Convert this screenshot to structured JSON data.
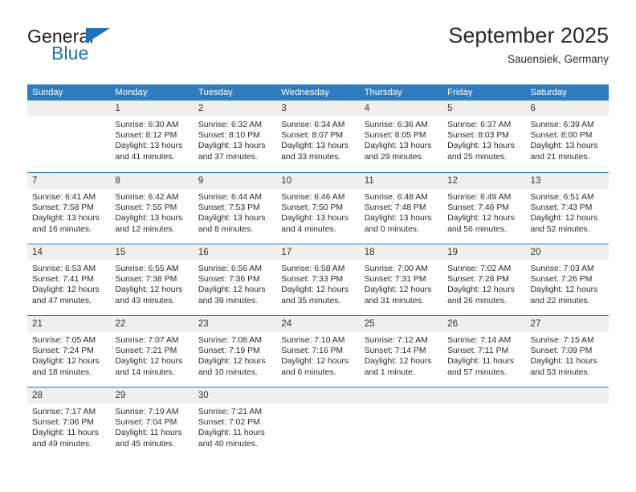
{
  "brand": {
    "name_dark": "General",
    "name_blue": "Blue",
    "accent_color": "#1f72b8"
  },
  "header": {
    "title": "September 2025",
    "subtitle": "Sauensiek, Germany"
  },
  "calendar": {
    "header_bg": "#2f7cbf",
    "daynum_bg": "#efefef",
    "weekdays": [
      "Sunday",
      "Monday",
      "Tuesday",
      "Wednesday",
      "Thursday",
      "Friday",
      "Saturday"
    ],
    "weeks": [
      [
        {
          "day": "",
          "empty": true,
          "sunrise": "",
          "sunset": "",
          "daylight1": "",
          "daylight2": ""
        },
        {
          "day": "1",
          "sunrise": "Sunrise: 6:30 AM",
          "sunset": "Sunset: 8:12 PM",
          "daylight1": "Daylight: 13 hours",
          "daylight2": "and 41 minutes."
        },
        {
          "day": "2",
          "sunrise": "Sunrise: 6:32 AM",
          "sunset": "Sunset: 8:10 PM",
          "daylight1": "Daylight: 13 hours",
          "daylight2": "and 37 minutes."
        },
        {
          "day": "3",
          "sunrise": "Sunrise: 6:34 AM",
          "sunset": "Sunset: 8:07 PM",
          "daylight1": "Daylight: 13 hours",
          "daylight2": "and 33 minutes."
        },
        {
          "day": "4",
          "sunrise": "Sunrise: 6:36 AM",
          "sunset": "Sunset: 8:05 PM",
          "daylight1": "Daylight: 13 hours",
          "daylight2": "and 29 minutes."
        },
        {
          "day": "5",
          "sunrise": "Sunrise: 6:37 AM",
          "sunset": "Sunset: 8:03 PM",
          "daylight1": "Daylight: 13 hours",
          "daylight2": "and 25 minutes."
        },
        {
          "day": "6",
          "sunrise": "Sunrise: 6:39 AM",
          "sunset": "Sunset: 8:00 PM",
          "daylight1": "Daylight: 13 hours",
          "daylight2": "and 21 minutes."
        }
      ],
      [
        {
          "day": "7",
          "sunrise": "Sunrise: 6:41 AM",
          "sunset": "Sunset: 7:58 PM",
          "daylight1": "Daylight: 13 hours",
          "daylight2": "and 16 minutes."
        },
        {
          "day": "8",
          "sunrise": "Sunrise: 6:42 AM",
          "sunset": "Sunset: 7:55 PM",
          "daylight1": "Daylight: 13 hours",
          "daylight2": "and 12 minutes."
        },
        {
          "day": "9",
          "sunrise": "Sunrise: 6:44 AM",
          "sunset": "Sunset: 7:53 PM",
          "daylight1": "Daylight: 13 hours",
          "daylight2": "and 8 minutes."
        },
        {
          "day": "10",
          "sunrise": "Sunrise: 6:46 AM",
          "sunset": "Sunset: 7:50 PM",
          "daylight1": "Daylight: 13 hours",
          "daylight2": "and 4 minutes."
        },
        {
          "day": "11",
          "sunrise": "Sunrise: 6:48 AM",
          "sunset": "Sunset: 7:48 PM",
          "daylight1": "Daylight: 13 hours",
          "daylight2": "and 0 minutes."
        },
        {
          "day": "12",
          "sunrise": "Sunrise: 6:49 AM",
          "sunset": "Sunset: 7:46 PM",
          "daylight1": "Daylight: 12 hours",
          "daylight2": "and 56 minutes."
        },
        {
          "day": "13",
          "sunrise": "Sunrise: 6:51 AM",
          "sunset": "Sunset: 7:43 PM",
          "daylight1": "Daylight: 12 hours",
          "daylight2": "and 52 minutes."
        }
      ],
      [
        {
          "day": "14",
          "sunrise": "Sunrise: 6:53 AM",
          "sunset": "Sunset: 7:41 PM",
          "daylight1": "Daylight: 12 hours",
          "daylight2": "and 47 minutes."
        },
        {
          "day": "15",
          "sunrise": "Sunrise: 6:55 AM",
          "sunset": "Sunset: 7:38 PM",
          "daylight1": "Daylight: 12 hours",
          "daylight2": "and 43 minutes."
        },
        {
          "day": "16",
          "sunrise": "Sunrise: 6:56 AM",
          "sunset": "Sunset: 7:36 PM",
          "daylight1": "Daylight: 12 hours",
          "daylight2": "and 39 minutes."
        },
        {
          "day": "17",
          "sunrise": "Sunrise: 6:58 AM",
          "sunset": "Sunset: 7:33 PM",
          "daylight1": "Daylight: 12 hours",
          "daylight2": "and 35 minutes."
        },
        {
          "day": "18",
          "sunrise": "Sunrise: 7:00 AM",
          "sunset": "Sunset: 7:31 PM",
          "daylight1": "Daylight: 12 hours",
          "daylight2": "and 31 minutes."
        },
        {
          "day": "19",
          "sunrise": "Sunrise: 7:02 AM",
          "sunset": "Sunset: 7:28 PM",
          "daylight1": "Daylight: 12 hours",
          "daylight2": "and 26 minutes."
        },
        {
          "day": "20",
          "sunrise": "Sunrise: 7:03 AM",
          "sunset": "Sunset: 7:26 PM",
          "daylight1": "Daylight: 12 hours",
          "daylight2": "and 22 minutes."
        }
      ],
      [
        {
          "day": "21",
          "sunrise": "Sunrise: 7:05 AM",
          "sunset": "Sunset: 7:24 PM",
          "daylight1": "Daylight: 12 hours",
          "daylight2": "and 18 minutes."
        },
        {
          "day": "22",
          "sunrise": "Sunrise: 7:07 AM",
          "sunset": "Sunset: 7:21 PM",
          "daylight1": "Daylight: 12 hours",
          "daylight2": "and 14 minutes."
        },
        {
          "day": "23",
          "sunrise": "Sunrise: 7:08 AM",
          "sunset": "Sunset: 7:19 PM",
          "daylight1": "Daylight: 12 hours",
          "daylight2": "and 10 minutes."
        },
        {
          "day": "24",
          "sunrise": "Sunrise: 7:10 AM",
          "sunset": "Sunset: 7:16 PM",
          "daylight1": "Daylight: 12 hours",
          "daylight2": "and 6 minutes."
        },
        {
          "day": "25",
          "sunrise": "Sunrise: 7:12 AM",
          "sunset": "Sunset: 7:14 PM",
          "daylight1": "Daylight: 12 hours",
          "daylight2": "and 1 minute."
        },
        {
          "day": "26",
          "sunrise": "Sunrise: 7:14 AM",
          "sunset": "Sunset: 7:11 PM",
          "daylight1": "Daylight: 11 hours",
          "daylight2": "and 57 minutes."
        },
        {
          "day": "27",
          "sunrise": "Sunrise: 7:15 AM",
          "sunset": "Sunset: 7:09 PM",
          "daylight1": "Daylight: 11 hours",
          "daylight2": "and 53 minutes."
        }
      ],
      [
        {
          "day": "28",
          "sunrise": "Sunrise: 7:17 AM",
          "sunset": "Sunset: 7:06 PM",
          "daylight1": "Daylight: 11 hours",
          "daylight2": "and 49 minutes."
        },
        {
          "day": "29",
          "sunrise": "Sunrise: 7:19 AM",
          "sunset": "Sunset: 7:04 PM",
          "daylight1": "Daylight: 11 hours",
          "daylight2": "and 45 minutes."
        },
        {
          "day": "30",
          "sunrise": "Sunrise: 7:21 AM",
          "sunset": "Sunset: 7:02 PM",
          "daylight1": "Daylight: 11 hours",
          "daylight2": "and 40 minutes."
        },
        {
          "day": "",
          "empty": true,
          "sunrise": "",
          "sunset": "",
          "daylight1": "",
          "daylight2": ""
        },
        {
          "day": "",
          "empty": true,
          "sunrise": "",
          "sunset": "",
          "daylight1": "",
          "daylight2": ""
        },
        {
          "day": "",
          "empty": true,
          "sunrise": "",
          "sunset": "",
          "daylight1": "",
          "daylight2": ""
        },
        {
          "day": "",
          "empty": true,
          "sunrise": "",
          "sunset": "",
          "daylight1": "",
          "daylight2": ""
        }
      ]
    ]
  }
}
